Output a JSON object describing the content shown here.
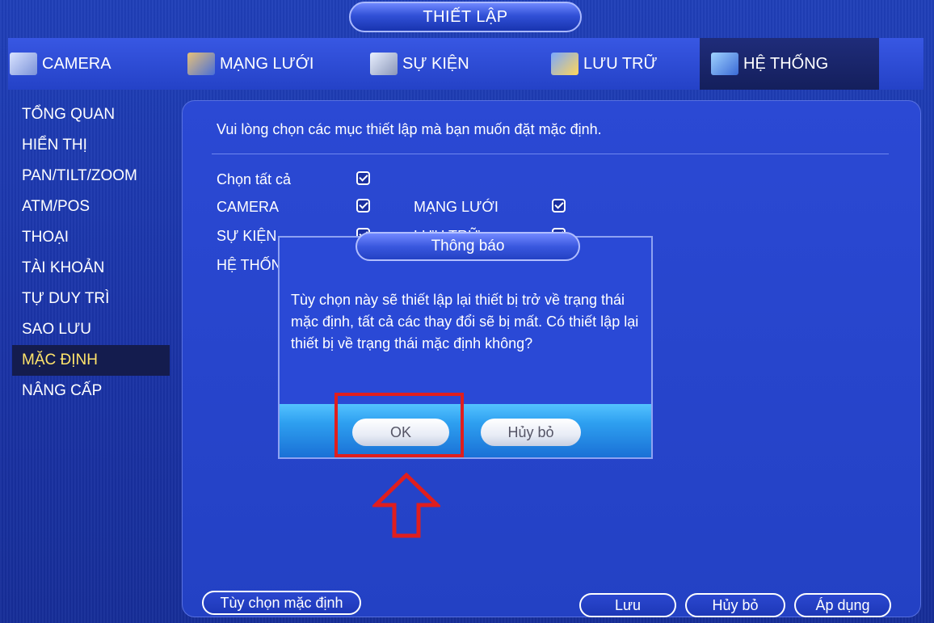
{
  "header": {
    "title": "THIẾT LẬP"
  },
  "tabs": [
    {
      "label": "CAMERA",
      "icon": "camera-icon"
    },
    {
      "label": "MẠNG LƯỚI",
      "icon": "network-icon"
    },
    {
      "label": "SỰ KIỆN",
      "icon": "event-icon"
    },
    {
      "label": "LƯU TRỮ",
      "icon": "storage-icon"
    },
    {
      "label": "HỆ THỐNG",
      "icon": "system-icon"
    }
  ],
  "sidebar": {
    "items": [
      {
        "label": "TỔNG QUAN"
      },
      {
        "label": "HIỂN THỊ"
      },
      {
        "label": "PAN/TILT/ZOOM"
      },
      {
        "label": "ATM/POS"
      },
      {
        "label": "THOẠI"
      },
      {
        "label": "TÀI KHOẢN"
      },
      {
        "label": "TỰ DUY TRÌ"
      },
      {
        "label": "SAO LƯU"
      },
      {
        "label": "MẶC ĐỊNH"
      },
      {
        "label": "NÂNG CẤP"
      }
    ]
  },
  "main": {
    "instruction": "Vui lòng chọn các mục thiết lập mà bạn muốn đặt mặc định.",
    "options": {
      "select_all": "Chọn tất cả",
      "camera": "CAMERA",
      "network": "MẠNG LƯỚI",
      "event": "SỰ KIỆN",
      "storage": "LƯU TRỮ",
      "system": "HỆ THỐNG"
    }
  },
  "footer": {
    "default_options": "Tùy chọn mặc định",
    "save": "Lưu",
    "cancel": "Hủy bỏ",
    "apply": "Áp dụng"
  },
  "dialog": {
    "title": "Thông báo",
    "message": "Tùy chọn này sẽ thiết lập lại thiết bị trở về trạng thái mặc định, tất cả các thay đổi sẽ bị mất. Có thiết lập lại thiết bị về trạng thái mặc định không?",
    "ok": "OK",
    "cancel": "Hủy bỏ"
  },
  "colors": {
    "background": "#1f3fb8",
    "active_sidebar_text": "#ffe46b",
    "highlight": "#e01e1e"
  }
}
